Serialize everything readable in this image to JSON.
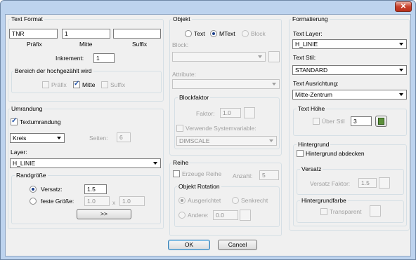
{
  "window": {
    "close_label": "✕"
  },
  "text_format": {
    "title": "Text Format",
    "prefix_value": "TNR",
    "middle_value": "1",
    "suffix_value": "",
    "prefix_label": "Präfix",
    "middle_label": "Mitte",
    "suffix_label": "Suffix",
    "increment_label": "Inkrement:",
    "increment_value": "1",
    "range_title": "Bereich der hochgezählt wird",
    "range_prefix": "Präfix",
    "range_middle": "Mitte",
    "range_suffix": "Suffix"
  },
  "umrandung": {
    "title": "Umrandung",
    "textumrandung_label": "Textumrandung",
    "shape_value": "Kreis",
    "seiten_label": "Seiten:",
    "seiten_value": "6",
    "layer_label": "Layer:",
    "layer_value": "H_LINIE",
    "randgroesse_title": "Randgröße",
    "versatz_label": "Versatz:",
    "versatz_value": "1.5",
    "feste_label": "feste Größe:",
    "feste_w": "1.0",
    "feste_x": "x",
    "feste_h": "1.0",
    "expand_label": ">>"
  },
  "objekt": {
    "title": "Objekt",
    "radio_text": "Text",
    "radio_mtext": "MText",
    "radio_block": "Block",
    "block_label": "Block:",
    "block_value": "",
    "attribute_label": "Attribute:",
    "attribute_value": "",
    "blockfaktor_title": "Blockfaktor",
    "faktor_label": "Faktor:",
    "faktor_value": "1.0",
    "sysvar_label": "Verwende Systemvariable:",
    "sysvar_value": "DIMSCALE"
  },
  "reihe": {
    "title": "Reihe",
    "erzeuge_label": "Erzeuge Reihe",
    "anzahl_label": "Anzahl:",
    "anzahl_value": "5",
    "rotation_title": "Objekt Rotation",
    "ausgerichtet": "Ausgerichtet",
    "senkrecht": "Senkrecht",
    "andere": "Andere:",
    "andere_value": "0.0"
  },
  "formatierung": {
    "title": "Formatierung",
    "layer_label": "Text Layer:",
    "layer_value": "H_LINIE",
    "stil_label": "Text Stil:",
    "stil_value": "STANDARD",
    "ausrichtung_label": "Text Ausrichtung:",
    "ausrichtung_value": "Mitte-Zentrum",
    "hoehe_title": "Text Höhe",
    "ueber_stil": "Über Stil",
    "hoehe_value": "3"
  },
  "hintergrund": {
    "title": "Hintergrund",
    "abdecken_label": "Hintergrund abdecken",
    "versatz_title": "Versatz",
    "versatz_faktor_label": "Versatz Faktor:",
    "versatz_faktor_value": "1.5",
    "farbe_title": "Hintergrundfarbe",
    "transparent_label": "Transparent"
  },
  "buttons": {
    "ok": "OK",
    "cancel": "Cancel"
  }
}
